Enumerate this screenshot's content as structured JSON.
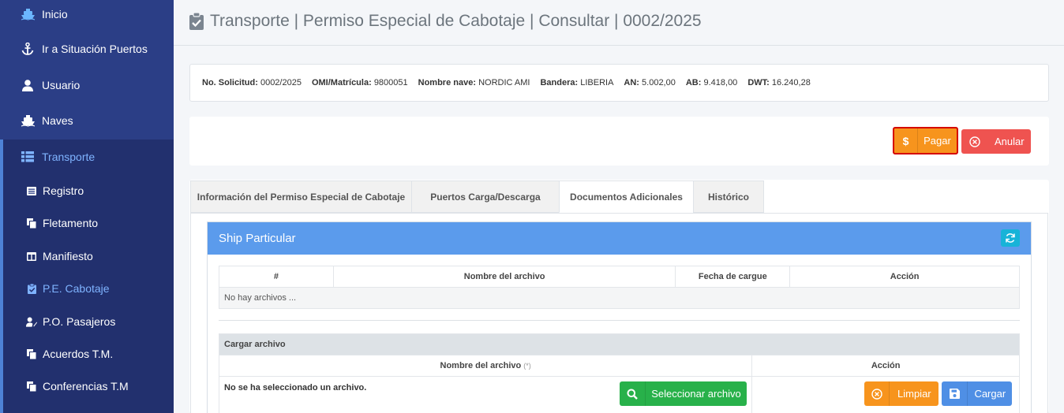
{
  "sidebar": {
    "items": [
      {
        "label": "Inicio",
        "icon": "ship-icon"
      },
      {
        "label": "Ir a Situación Puertos",
        "icon": "anchor-icon"
      },
      {
        "label": "Usuario",
        "icon": "user-icon"
      },
      {
        "label": "Naves",
        "icon": "ship-icon"
      },
      {
        "label": "Transporte",
        "icon": "list-icon"
      }
    ],
    "subitems": [
      {
        "label": "Registro",
        "icon": "list-alt-icon"
      },
      {
        "label": "Fletamento",
        "icon": "copy-icon"
      },
      {
        "label": "Manifiesto",
        "icon": "columns-icon"
      },
      {
        "label": "P.E. Cabotaje",
        "icon": "clipboard-check-icon",
        "active": true
      },
      {
        "label": "P.O. Pasajeros",
        "icon": "user-edit-icon"
      },
      {
        "label": "Acuerdos T.M.",
        "icon": "copy-icon"
      },
      {
        "label": "Conferencias T.M",
        "icon": "copy-icon"
      }
    ]
  },
  "header": {
    "title": "Transporte | Permiso Especial de Cabotaje | Consultar | 0002/2025"
  },
  "info": {
    "solicitud_label": "No. Solicitud:",
    "solicitud": "0002/2025",
    "omi_label": "OMI/Matrícula:",
    "omi": "9800051",
    "nave_label": "Nombre nave:",
    "nave": "NORDIC AMI",
    "bandera_label": "Bandera:",
    "bandera": "LIBERIA",
    "an_label": "AN:",
    "an": "5.002,00",
    "ab_label": "AB:",
    "ab": "9.418,00",
    "dwt_label": "DWT:",
    "dwt": "16.240,28"
  },
  "actions": {
    "pay_label": "Pagar",
    "cancel_label": "Anular"
  },
  "tabs": [
    {
      "label": "Información del Permiso Especial de Cabotaje"
    },
    {
      "label": "Puertos Carga/Descarga"
    },
    {
      "label": "Documentos Adicionales",
      "active": true
    },
    {
      "label": "Histórico"
    }
  ],
  "panel": {
    "title": "Ship Particular",
    "files_table": {
      "headers": [
        "#",
        "Nombre del archivo",
        "Fecha de cargue",
        "Acción"
      ],
      "empty_text": "No hay archivos ..."
    },
    "upload": {
      "caption": "Cargar archivo",
      "col_name": "Nombre del archivo",
      "required_mark": "(*)",
      "col_action": "Acción",
      "no_file_text": "No se ha seleccionado un archivo.",
      "select_label": "Seleccionar archivo",
      "clear_label": "Limpiar",
      "load_label": "Cargar"
    }
  },
  "colors": {
    "sidebar": "#2b3e86",
    "panel_header": "#5b9bec",
    "pay": "#f7941d",
    "cancel": "#ef5350",
    "select": "#28b14a",
    "load": "#4f8fe5"
  }
}
